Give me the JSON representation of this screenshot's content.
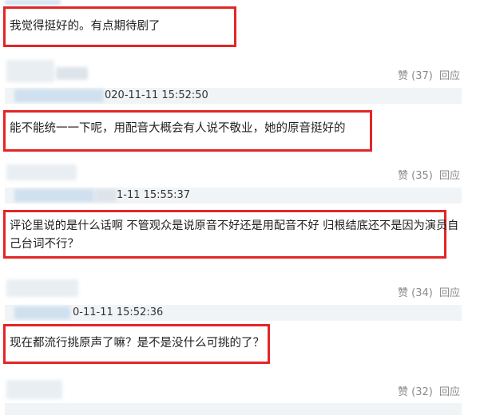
{
  "comments": [
    {
      "text": "我觉得挺好的。有点期待剧了"
    },
    {
      "text": "能不能统一一下呢，用配音大概会有人说不敬业，她的原音挺好的"
    },
    {
      "text_line1": "评论里说的是什么话啊 不管观众是说原音不好还是用配音不好 归根结底还不是因为演员自",
      "text_line2": "己台词不行？"
    },
    {
      "text": "现在都流行挑原声了嘛？是不是没什么可挑的了？"
    }
  ],
  "rows": [
    {
      "like": "赞 (37)",
      "reply": "回应",
      "time": "020-11-11 15:52:50"
    },
    {
      "like": "赞 (35)",
      "reply": "回应",
      "time": "1-11 15:55:37"
    },
    {
      "like": "赞 (34)",
      "reply": "回应",
      "time": "0-11-11 15:52:36"
    },
    {
      "like": "赞 (32)",
      "reply": "回应"
    }
  ]
}
